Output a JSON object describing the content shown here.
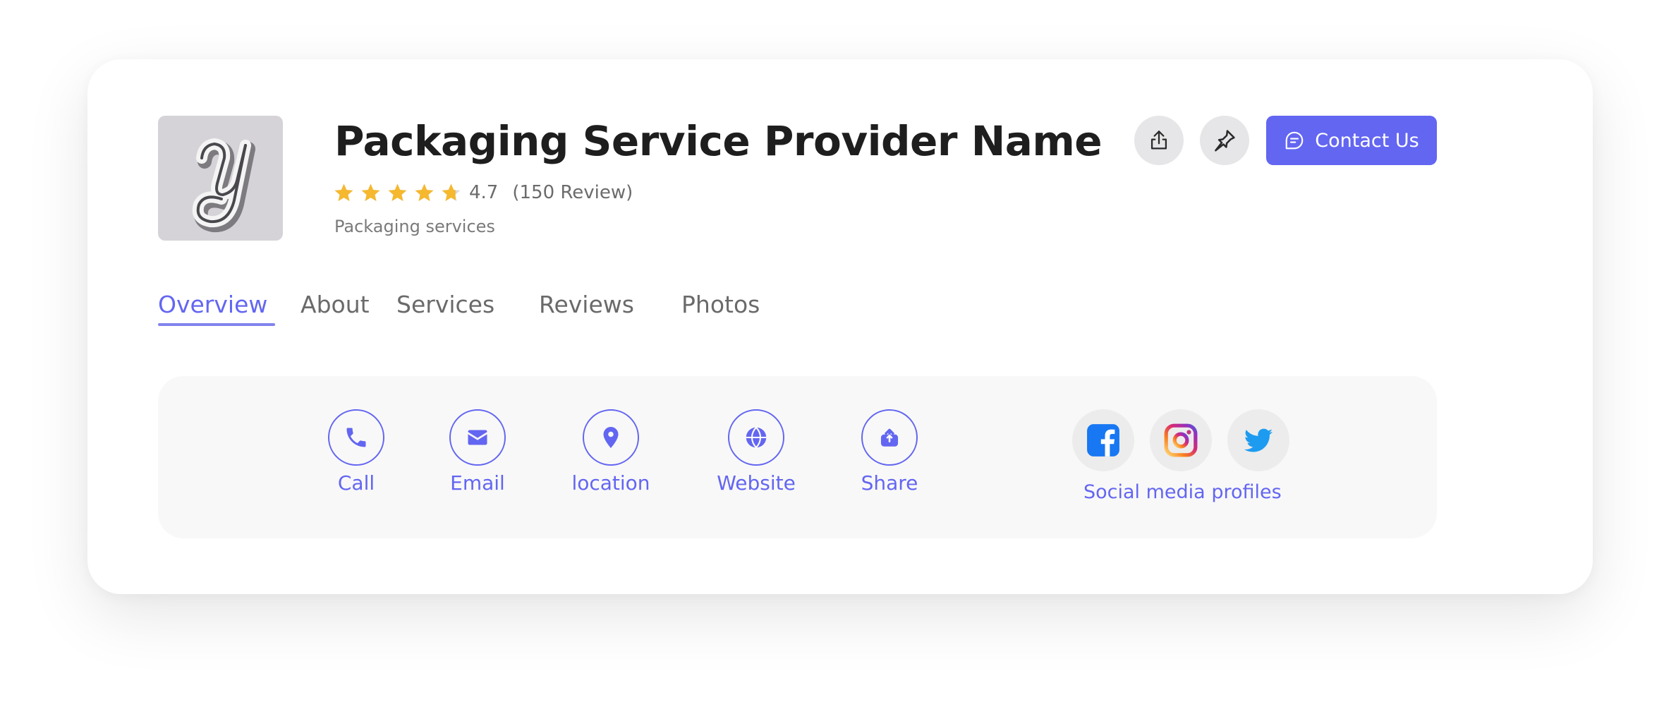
{
  "provider": {
    "name": "Packaging Service Provider Name",
    "rating": 4.7,
    "rating_label": "4.7",
    "review_count_label": "(150 Review)",
    "category": "Packaging services",
    "logo_icon": "script-y-logo"
  },
  "header_actions": {
    "share_icon": "upload-share-icon",
    "pin_icon": "pin-icon",
    "contact_label": "Contact Us",
    "contact_icon": "chat-bubble-icon"
  },
  "tabs": [
    {
      "label": "Overview",
      "active": true
    },
    {
      "label": "About",
      "active": false
    },
    {
      "label": "Services",
      "active": false
    },
    {
      "label": "Reviews",
      "active": false
    },
    {
      "label": "Photos",
      "active": false
    }
  ],
  "actions": [
    {
      "label": "Call",
      "icon": "phone-icon"
    },
    {
      "label": "Email",
      "icon": "envelope-icon"
    },
    {
      "label": "location",
      "icon": "map-pin-icon"
    },
    {
      "label": "Website",
      "icon": "globe-icon"
    },
    {
      "label": "Share",
      "icon": "share-icon"
    }
  ],
  "social": {
    "label": "Social media profiles",
    "profiles": [
      {
        "network": "facebook",
        "icon": "facebook-icon"
      },
      {
        "network": "instagram",
        "icon": "instagram-icon"
      },
      {
        "network": "twitter",
        "icon": "twitter-icon"
      }
    ]
  },
  "colors": {
    "accent": "#6366f1",
    "star": "#f5b82e",
    "title": "#1e1e1e",
    "muted": "#6b6b6b"
  }
}
